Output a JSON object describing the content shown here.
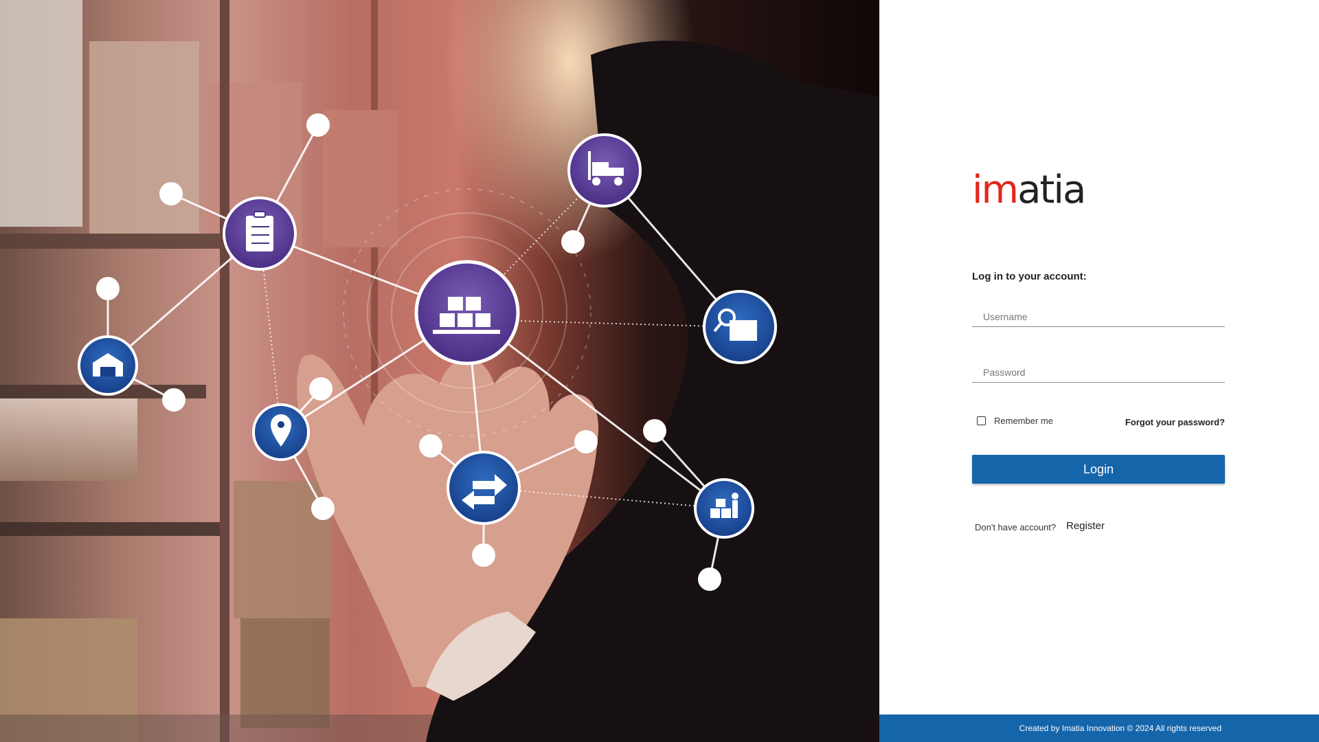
{
  "hero": {
    "image": "warehouse-logistics-network-photo",
    "icons": [
      "clipboard-checklist-icon",
      "forklift-icon",
      "boxes-pallet-icon",
      "search-folder-icon",
      "warehouse-icon",
      "location-pin-icon",
      "transfer-arrows-icon",
      "worker-boxes-icon"
    ]
  },
  "brand": {
    "logo_prefix": "im",
    "logo_suffix": "atia",
    "prefix_color": "#e1261c",
    "suffix_color": "#222222"
  },
  "login": {
    "heading": "Log in to your account:",
    "username_placeholder": "Username",
    "username_value": "",
    "password_placeholder": "Password",
    "password_value": "",
    "remember_label": "Remember me",
    "remember_checked": false,
    "forgot_label": "Forgot your password?",
    "submit_label": "Login",
    "no_account_text": "Don't have account?",
    "register_label": "Register"
  },
  "footer": {
    "text": "Created by Imatia Innovation © 2024 All rights reserved"
  },
  "colors": {
    "accent": "#1565ab",
    "node_blue": "#1f4c9c",
    "node_purple": "#5a3c94"
  }
}
